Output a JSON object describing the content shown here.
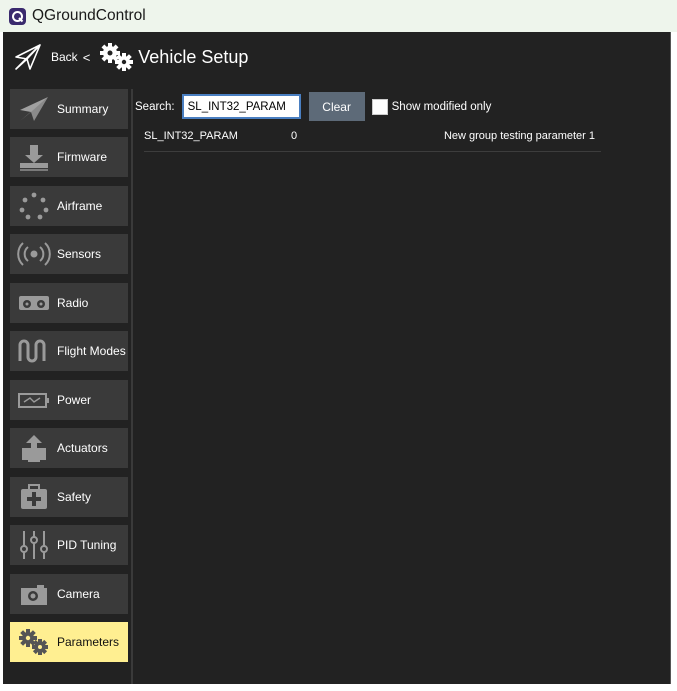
{
  "window": {
    "title": "QGroundControl"
  },
  "toolbar": {
    "back_label": "Back",
    "back_separator": "<",
    "page_title": "Vehicle Setup"
  },
  "sidebar": {
    "items": [
      {
        "label": "Summary",
        "icon": "paper-plane-icon",
        "active": false
      },
      {
        "label": "Firmware",
        "icon": "download-icon",
        "active": false
      },
      {
        "label": "Airframe",
        "icon": "airframe-icon",
        "active": false
      },
      {
        "label": "Sensors",
        "icon": "radio-waves-icon",
        "active": false
      },
      {
        "label": "Radio",
        "icon": "radio-controller-icon",
        "active": false
      },
      {
        "label": "Flight Modes",
        "icon": "waveform-icon",
        "active": false
      },
      {
        "label": "Power",
        "icon": "battery-icon",
        "active": false
      },
      {
        "label": "Actuators",
        "icon": "actuator-icon",
        "active": false
      },
      {
        "label": "Safety",
        "icon": "first-aid-icon",
        "active": false
      },
      {
        "label": "PID Tuning",
        "icon": "sliders-icon",
        "active": false
      },
      {
        "label": "Camera",
        "icon": "camera-icon",
        "active": false
      },
      {
        "label": "Parameters",
        "icon": "gears-icon",
        "active": true
      }
    ]
  },
  "search": {
    "label": "Search:",
    "value": "SL_INT32_PARAM",
    "clear_label": "Clear",
    "modified_only_label": "Show modified only",
    "modified_only_checked": false
  },
  "params": [
    {
      "name": "SL_INT32_PARAM",
      "value": "0",
      "description": "New group testing parameter 1"
    }
  ],
  "colors": {
    "active_tab": "#ffef91",
    "nav_bg": "#3a3a3a",
    "app_bg": "#222222",
    "clear_button": "#5d6a78"
  }
}
